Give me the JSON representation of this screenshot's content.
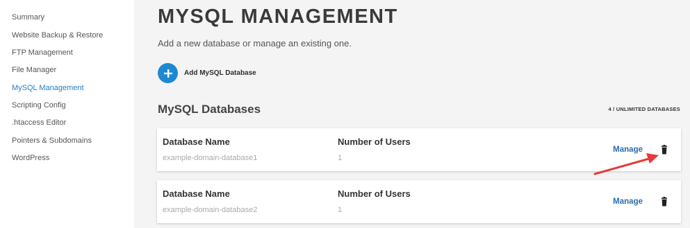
{
  "sidebar": {
    "items": [
      {
        "label": "Summary",
        "active": false
      },
      {
        "label": "Website Backup & Restore",
        "active": false
      },
      {
        "label": "FTP Management",
        "active": false
      },
      {
        "label": "File Manager",
        "active": false
      },
      {
        "label": "MySQL Management",
        "active": true
      },
      {
        "label": "Scripting Config",
        "active": false
      },
      {
        "label": ".htaccess Editor",
        "active": false
      },
      {
        "label": "Pointers & Subdomains",
        "active": false
      },
      {
        "label": "WordPress",
        "active": false
      }
    ]
  },
  "main": {
    "title": "MYSQL MANAGEMENT",
    "subtitle": "Add a new database or manage an existing one.",
    "add_button": {
      "label": "Add MySQL Database",
      "icon": "plus-icon"
    },
    "section_title": "MySQL Databases",
    "db_count": "4 / UNLIMITED DATABASES",
    "databases": [
      {
        "name_header": "Database Name",
        "name": "example-domain-database1",
        "users_header": "Number of Users",
        "users": "1",
        "manage_label": "Manage",
        "delete_icon": "trash-icon"
      },
      {
        "name_header": "Database Name",
        "name": "example-domain-database2",
        "users_header": "Number of Users",
        "users": "1",
        "manage_label": "Manage",
        "delete_icon": "trash-icon"
      }
    ]
  },
  "colors": {
    "accent": "#1f88d2",
    "active_nav": "#2a7dc0",
    "link": "#2a6eb0",
    "annotation_arrow": "#e23b3b"
  }
}
